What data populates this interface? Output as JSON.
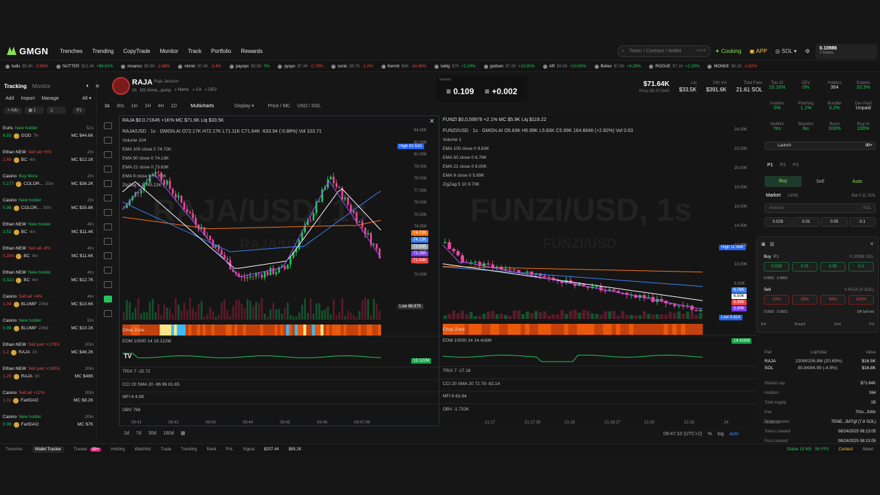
{
  "brand": "GMGN",
  "nav": [
    "Trenches",
    "Trending",
    "CopyTrade",
    "Monitor",
    "Track",
    "Portfolio",
    "Rewards"
  ],
  "search": {
    "placeholder": "Token / Contract / Wallet",
    "shortcut": "Ctrl+K"
  },
  "top_right": {
    "cooking": "Cooking",
    "app": "APP",
    "chain": "SOL",
    "balance": "0.10986",
    "wallets": "2 Wallets"
  },
  "ticker": [
    {
      "n": "balls",
      "p": "$5.8K",
      "c": "-0.68%"
    },
    {
      "n": "NUTTER",
      "p": "$12.4K",
      "c": "+98.61%"
    },
    {
      "n": "moanco",
      "p": "$5.8K",
      "c": "-2.88%"
    },
    {
      "n": "ninnin",
      "p": "$7.4K",
      "c": "-3.4%"
    },
    {
      "n": "payopc",
      "p": "$5.5K",
      "c": "0%"
    },
    {
      "n": "pyayo",
      "p": "$7.4K",
      "c": "-0.78%"
    },
    {
      "n": "sonic",
      "p": "$5.7K",
      "c": "-1.0%"
    },
    {
      "n": "Kermit",
      "p": "$8K",
      "c": "-14.48%"
    },
    {
      "n": "twilig",
      "p": "$7K",
      "c": "+2.24%"
    },
    {
      "n": "godsen",
      "p": "$7.2K",
      "c": "+13.91%"
    },
    {
      "n": "AR",
      "p": "$5.6K",
      "c": "+10.50%"
    },
    {
      "n": "Believ",
      "p": "$7.6K",
      "c": "+4.26%"
    },
    {
      "n": "ROGUE",
      "p": "$7.1K",
      "c": "+2.20%"
    },
    {
      "n": "MONKE",
      "p": "$6.1K",
      "c": "-2.62%"
    }
  ],
  "sidebar": {
    "tabs": [
      "Tracking",
      "Monitor"
    ],
    "actions": [
      "Add",
      "Import",
      "Manage"
    ],
    "filter_all": "All",
    "filter_adv": "+ Adv.",
    "filter_p": "P1",
    "feed": [
      {
        "w": "Euris",
        "act": "New holder",
        "t": "52s",
        "amt": "6.93",
        "tok": "GOD",
        "age": "7h",
        "mc": "MC $44.6K",
        "buy": true
      },
      {
        "w": "Ethan NEW",
        "act": "Sell all +6%",
        "t": "2m",
        "amt": "2.69",
        "tok": "BC",
        "age": "4m",
        "mc": "MC $12.1K",
        "buy": false
      },
      {
        "w": "Casino",
        "act": "Buy More",
        "t": "2m",
        "amt": "0.177",
        "tok": "COLOR...",
        "age": "30m",
        "mc": "MC $36.2K",
        "buy": true
      },
      {
        "w": "Casino",
        "act": "New holder",
        "t": "2m",
        "amt": "0.98",
        "tok": "COLOR...",
        "age": "30m",
        "mc": "MC $35.8K",
        "buy": true
      },
      {
        "w": "Ethan NEW",
        "act": "New holder",
        "t": "4m",
        "amt": "2.52",
        "tok": "BC",
        "age": "4m",
        "mc": "MC $11.4K",
        "buy": true
      },
      {
        "w": "Ethan NEW",
        "act": "Sell all -8%",
        "t": "4m",
        "amt": "0.294",
        "tok": "BC",
        "age": "4m",
        "mc": "MC $11.6K",
        "buy": false
      },
      {
        "w": "Ethan NEW",
        "act": "New holder",
        "t": "4m",
        "amt": "0.322",
        "tok": "BC",
        "age": "4m",
        "mc": "MC $12.7K",
        "buy": true
      },
      {
        "w": "Casino",
        "act": "Sell all +4%",
        "t": "4m",
        "amt": "1.04",
        "tok": "BLUMP",
        "age": "236d",
        "mc": "MC $10.6K",
        "buy": false
      },
      {
        "w": "Casino",
        "act": "New holder",
        "t": "5m",
        "amt": "0.99",
        "tok": "BLUMP",
        "age": "236d",
        "mc": "MC $10.1K",
        "buy": true
      },
      {
        "w": "Ethan NEW",
        "act": "Sell part +179%",
        "t": "20m",
        "amt": "1.2",
        "tok": "RAJA",
        "age": "1h",
        "mc": "MC $46.2K",
        "buy": false
      },
      {
        "w": "Ethan NEW",
        "act": "Sell part +190%",
        "t": "20m",
        "amt": "1.25",
        "tok": "RAJA",
        "age": "1h",
        "mc": "MC $48K",
        "buy": false
      },
      {
        "w": "Casino",
        "act": "Sell all +12%",
        "t": "20m",
        "amt": "1.11",
        "tok": "FartDAO",
        "age": "",
        "mc": "MC $8.2K",
        "buy": false
      },
      {
        "w": "Casino",
        "act": "New holder",
        "t": "20m",
        "amt": "0.99",
        "tok": "FartDAO",
        "age": "",
        "mc": "MC $7K",
        "buy": true
      }
    ]
  },
  "token": {
    "symbol": "RAJA",
    "fullname": "Raja Jackson",
    "age": "1h",
    "creator": "DS Gmra...pump",
    "sub_items": [
      "Name",
      "CA",
      "DEV"
    ]
  },
  "mid_box": {
    "label": "Velocity",
    "v1": "0.109",
    "v2": "+0.002"
  },
  "stats": [
    {
      "label": "$71.64K",
      "sub": "Price $0.071645",
      "big": true
    },
    {
      "label": "Liq",
      "val": "$33.5K"
    },
    {
      "label": "24h Vol",
      "val": "$391.6K"
    },
    {
      "label": "Total Fees",
      "val": "21.61 SOL"
    }
  ],
  "toolbar": [
    "1s",
    "30s",
    "1m",
    "1H",
    "4H",
    "1D",
    "Multicharts",
    "Display",
    "Price / MC",
    "USD / SOL"
  ],
  "chart_left": {
    "title": "RAJA  $0.0,71645  +1K%  MC $71.6K  Liq $33.5K",
    "line2": "RAJA/USD · 1s · GMGN.AI  O72.17K H72.17K L71.11K C71.64K -633.94 (-0.88%)  Vol 103.71",
    "indicators": [
      "Volume  104",
      "EMA 100 close 0  74.72K",
      "EMA 50 close 0  74.13K",
      "EMA 21 close 0  73.83K",
      "EMA 9 close 0  71.68K",
      "ZigZag 5 10  45.22K"
    ],
    "wm": "RAJA/USD, 1s",
    "wm2": "RAJA/USD",
    "yticks": [
      "84.00K",
      "82.00K",
      "81.00K",
      "79.00K",
      "78.00K",
      "77.00K",
      "76.00K",
      "75.00K",
      "74.00K",
      "73.00K",
      "72.00K",
      "71.00K",
      "70.00K"
    ],
    "high": "82.61K",
    "low": "68.87K",
    "pills": [
      "74.72K",
      "74.13K",
      "73.83K",
      "73.26K",
      "71.64K"
    ],
    "chop": "Chop Zone",
    "eom": "EOM 10000 14  19.122M",
    "trix": "TRIX 7  -15.72",
    "cci": "CCI 20 SMA 20  -96.96  61.65",
    "mfi": "MFI 6  4.98",
    "obv": "OBV  766",
    "times": [
      "09:41",
      "09:42",
      "09:43",
      "09:44",
      "09:45",
      "09:46",
      "09:47:09"
    ],
    "eom_pill": "19.122M"
  },
  "chart_right": {
    "title": "FUNZI  $0,0,59976  +2.1%  MC $5.9K  Liq $119.22",
    "line2": "FUNZI/USD · 1s · GMGN.AI  O5.83K H5.99K L5.83K C5.99K 164.6646 (+2.82%)  Vol 0.63",
    "indicators": [
      "Volume  1",
      "EMA 100 close 0  9.83K",
      "EMA 50 close 0  6.76K",
      "EMA 21 close 0  6.00K",
      "EMA 9 close 0  5.89K",
      "ZigZag 5 10  9.70K"
    ],
    "wm": "FUNZI/USD, 1s",
    "wm2": "FUNZI/USD",
    "yticks": [
      "24.00K",
      "22.00K",
      "20.00K",
      "18.00K",
      "16.00K",
      "14.00K",
      "12.00K",
      "10.00K",
      "8.00K"
    ],
    "high": "11.94K",
    "low": "5.81K",
    "pills": [
      "6.76K",
      "6.00K",
      "5.99K",
      "5.89K"
    ],
    "chop": "Chop Zone",
    "eom": "EOM 10000 14  14.416M",
    "trix": "TRIX 7  -17.16",
    "cci": "CCI 20 SMA 20  72.79  -82.14",
    "mfi": "MFI 6  63.84",
    "obv": "OBV  -1.732K",
    "times": [
      "21:17",
      "21:17:30",
      "21:18",
      "21:18:27",
      "21:20",
      "21:33",
      "24",
      "04:26:30"
    ],
    "eom_pill": "14.416M"
  },
  "bottom": {
    "ranges": [
      "1d",
      "7d",
      "30d",
      "180d"
    ],
    "clock": "09:47:10 (UTC+2)",
    "pct": "%",
    "log": "log",
    "auto": "auto"
  },
  "right_panel": {
    "row1": [
      {
        "l": "Top 10",
        "v": "23.16%"
      },
      {
        "l": "DEV",
        "v": "0%"
      },
      {
        "l": "Holders",
        "v": "364"
      },
      {
        "l": "Snipers",
        "v": "33.3%"
      }
    ],
    "row2": [
      {
        "l": "Insiders",
        "v": "0%"
      },
      {
        "l": "Phishing",
        "v": "1.1%"
      },
      {
        "l": "Bundler",
        "v": "0.2%"
      },
      {
        "l": "Dex Paid",
        "v": "Unpaid"
      }
    ],
    "row3": [
      {
        "l": "NoMint",
        "v": "Yes"
      },
      {
        "l": "Blacklist",
        "v": "No"
      },
      {
        "l": "Burnt",
        "v": "100%"
      },
      {
        "l": "Rug %",
        "v": "100%"
      }
    ],
    "launch": "Launch",
    "launch_val": "99+",
    "presets": [
      "P1",
      "P2",
      "P3"
    ],
    "buy": "Buy",
    "sell": "Sell",
    "auto": "Auto",
    "market": "Market",
    "limit": "Limit",
    "bal": "Bal 0.11 SOL",
    "amount": "Amount",
    "sol": "SOL",
    "amounts": [
      "0.028",
      "0.01",
      "0.05",
      "0.1"
    ],
    "buy2": "Buy",
    "buy_bal": "0.10986 SOL",
    "buy_amts": [
      "0.028",
      "0.01",
      "0.05",
      "0.1"
    ],
    "sell2": "Sell",
    "sell_bal": "0 RAJA (0 SOL)",
    "sell_amts": [
      "10%",
      "25%",
      "50%",
      "100%"
    ],
    "fees": "0.0001",
    "fees2": "0.0001",
    "off": "Off Sell Init",
    "cols": [
      "Bal",
      "Bought",
      "Sold",
      "PnL"
    ],
    "liq_head": [
      "Pair",
      "Liq/Initial",
      "Value"
    ],
    "liq_rows": [
      {
        "a": "RAJA",
        "b": "230M/206.9M (20.69%)",
        "c": "$16.5K"
      },
      {
        "a": "SOL",
        "b": "80.84/84.99 (-4.9%)",
        "c": "$16.8K"
      }
    ],
    "info": [
      {
        "l": "Market cap",
        "v": "$71.64K"
      },
      {
        "l": "Holders",
        "v": "364"
      },
      {
        "l": "Total supply",
        "v": "1B"
      },
      {
        "l": "Pair",
        "v": "7tXo...fcMv"
      },
      {
        "l": "Token creator",
        "v": "7EfdE...BATgf (7.8 SOL)"
      },
      {
        "l": "Token created",
        "v": "08/24/2025 08:13:05"
      },
      {
        "l": "Pool created",
        "v": "08/24/2025 08:13:05"
      }
    ]
  },
  "footer": {
    "items": [
      "Trenches",
      "Wallet Tracker",
      "Tracker",
      "Holding",
      "Watchlist",
      "Trade",
      "Trending",
      "Rank",
      "PnL",
      "Signal"
    ],
    "tracker_badge": "99+",
    "sol1": "$207.44",
    "sol2": "$85.2K",
    "stable": "Stable 18 MS · 56 FPS",
    "contest": "Contest",
    "about": "About"
  },
  "colors": {
    "accent": "#8be04e",
    "green": "#22c55e",
    "red": "#ef4444",
    "blue": "#3b82f6",
    "orange": "#f97316"
  }
}
